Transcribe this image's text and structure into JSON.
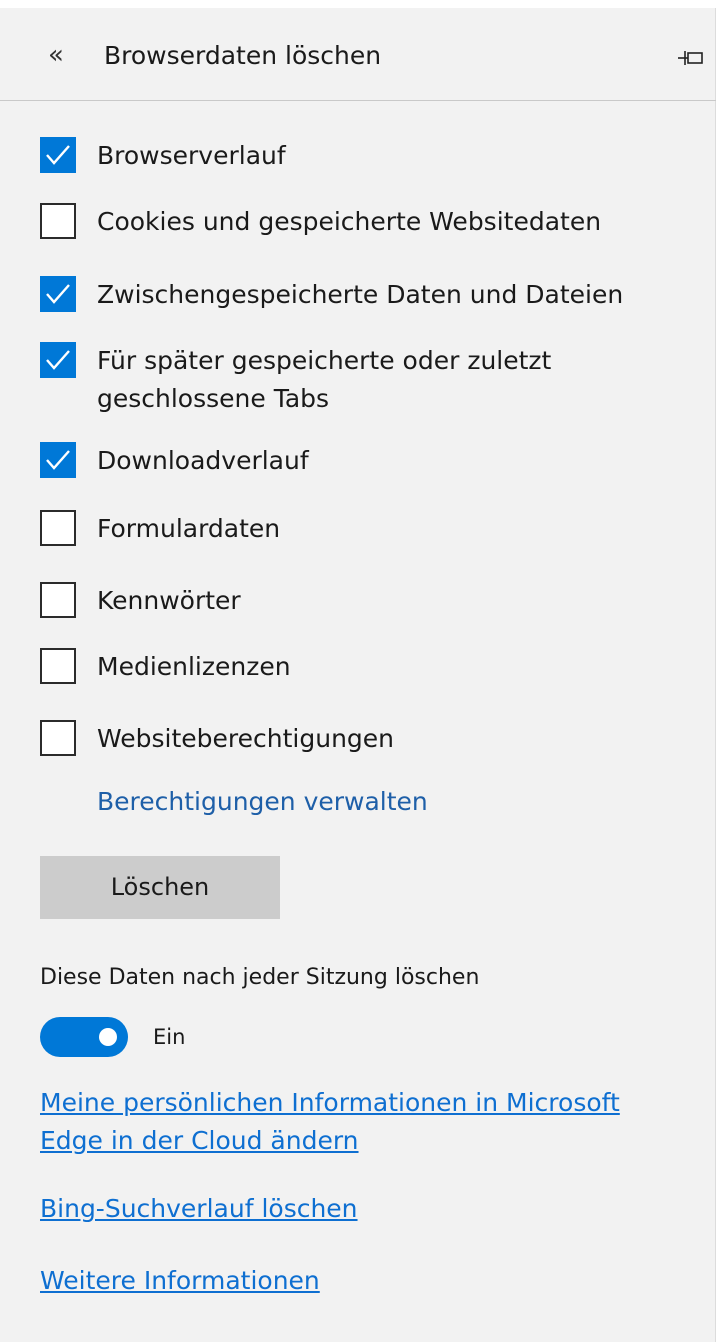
{
  "header": {
    "back_icon": "«",
    "title": "Browserdaten löschen",
    "pin_icon": "pin-icon"
  },
  "options": [
    {
      "label": "Browserverlauf",
      "checked": true
    },
    {
      "label": "Cookies und gespeicherte Websitedaten",
      "checked": false
    },
    {
      "label": "Zwischengespeicherte Daten und Dateien",
      "checked": true
    },
    {
      "label": "Für später gespeicherte oder zuletzt geschlossene Tabs",
      "checked": true
    },
    {
      "label": "Downloadverlauf",
      "checked": true
    },
    {
      "label": "Formulardaten",
      "checked": false
    },
    {
      "label": "Kennwörter",
      "checked": false
    },
    {
      "label": "Medienlizenzen",
      "checked": false
    },
    {
      "label": "Websiteberechtigungen",
      "checked": false
    }
  ],
  "manage_permissions_link": "Berechtigungen verwalten",
  "clear_button": "Löschen",
  "session": {
    "label": "Diese Daten nach jeder Sitzung löschen",
    "toggle_on": true,
    "toggle_state": "Ein"
  },
  "links": {
    "cloud_info": "Meine persönlichen Informationen in Microsoft Edge in der Cloud ändern",
    "bing_history": "Bing-Suchverlauf löschen",
    "more_info": "Weitere Informationen"
  },
  "colors": {
    "accent": "#0078d7",
    "panel_bg": "#f2f2f2",
    "link": "#0e6fd1"
  }
}
